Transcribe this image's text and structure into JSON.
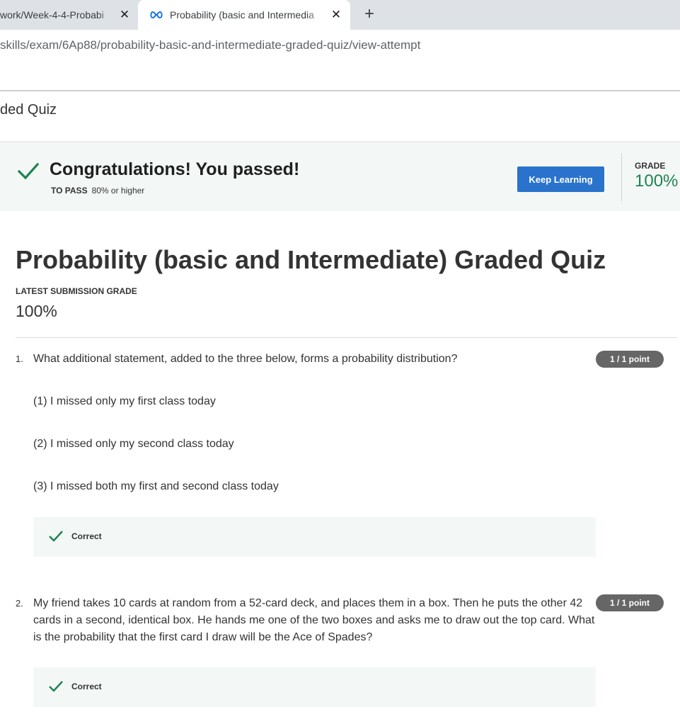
{
  "browser": {
    "tabs": [
      {
        "title": "work/Week-4-4-Probabi",
        "active": false
      },
      {
        "title": "Probability (basic and Intermedia",
        "active": true
      }
    ],
    "url": "skills/exam/6Ap88/probability-basic-and-intermediate-graded-quiz/view-attempt"
  },
  "breadcrumb": {
    "text": "ded Quiz"
  },
  "banner": {
    "title": "Congratulations! You passed!",
    "to_pass_label": "TO PASS",
    "to_pass_value": "80% or higher",
    "button_label": "Keep Learning",
    "grade_label": "GRADE",
    "grade_value": "100%"
  },
  "quiz": {
    "title": "Probability (basic and Intermediate) Graded Quiz",
    "latest_label": "LATEST SUBMISSION GRADE",
    "latest_value": "100%"
  },
  "questions": [
    {
      "number": "1.",
      "text": "What additional statement, added to the three below, forms a probability distribution?",
      "points": "1 / 1 point",
      "options": [
        "(1) I missed only my first class today",
        "(2) I missed only my second class today",
        "(3) I missed both my first and second class today"
      ],
      "feedback": "Correct"
    },
    {
      "number": "2.",
      "text": "My friend takes 10 cards at random from a 52-card deck, and places them in a box. Then he puts the other 42 cards in a second, identical box. He hands me one of the two boxes and asks me to draw out the top card. What is the probability that the first card I draw will be the Ace of Spades?",
      "points": "1 / 1 point",
      "feedback": "Correct"
    }
  ],
  "colors": {
    "primary_button": "#2a73cc",
    "success_green": "#1f8354",
    "banner_bg": "#f3f8f6",
    "pill_bg": "#666666"
  },
  "icons": {
    "tab_close": "close-icon",
    "new_tab": "plus-icon",
    "favicon": "coursera-infinity-icon",
    "check": "check-icon"
  }
}
